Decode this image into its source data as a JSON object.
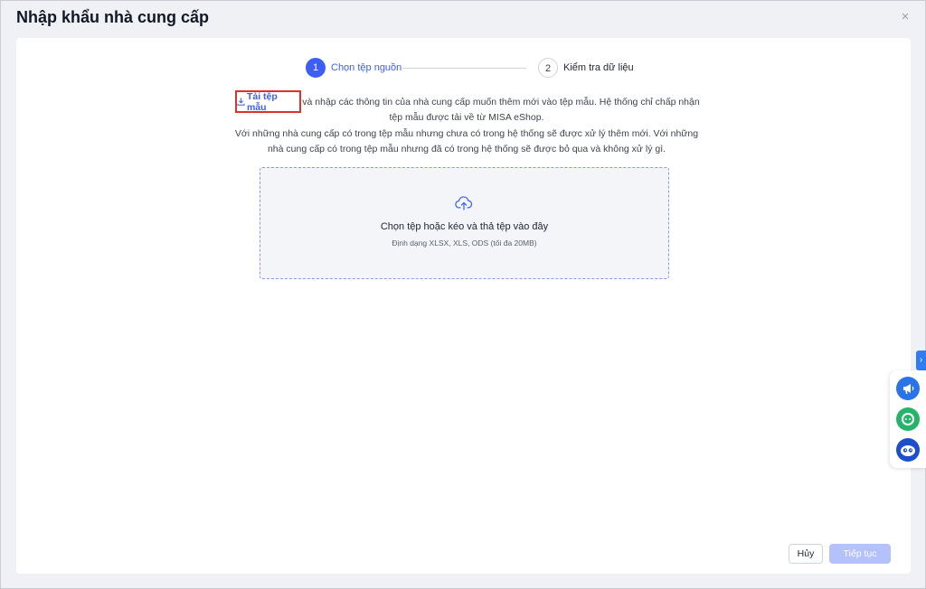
{
  "dialog": {
    "title": "Nhập khẩu nhà cung cấp",
    "close": "×"
  },
  "stepper": [
    {
      "number": "1",
      "label": "Chọn tệp nguồn"
    },
    {
      "number": "2",
      "label": "Kiểm tra dữ liệu"
    }
  ],
  "intro": {
    "link_label": "Tải tệp mẫu",
    "text": "và nhập các thông tin của nhà cung cấp muốn thêm mới vào tệp mẫu. Hệ thống chỉ chấp nhận tệp mẫu được tải về từ MISA eShop.",
    "note": "Với những nhà cung cấp có trong tệp mẫu nhưng chưa có trong hệ thống sẽ được xử lý thêm mới. Với những nhà cung cấp có trong tệp mẫu nhưng đã có trong hệ thống sẽ được bỏ qua và không xử lý gì."
  },
  "dropzone": {
    "title": "Chọn tệp hoặc kéo và thả tệp vào đây",
    "subtitle": "Định dạng XLSX, XLS, ODS (tối đa 20MB)",
    "icon": "cloud-upload-icon"
  },
  "footer": {
    "cancel_label": "Hủy",
    "next_label": "Tiếp tục"
  },
  "side_widgets": {
    "toggle": "›",
    "buttons": [
      "megaphone-icon",
      "chat-icon",
      "mascot-icon"
    ]
  },
  "colors": {
    "primary": "#3d5df5",
    "highlight_border": "#d9342b",
    "disabled_button": "#b4c1fa"
  }
}
